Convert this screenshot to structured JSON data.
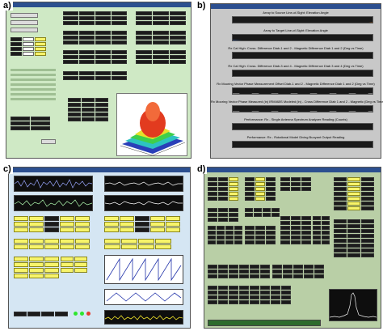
{
  "labels": {
    "a": "a)",
    "b": "b)",
    "c": "c)",
    "d": "d)"
  },
  "colors": {
    "panel_a_bg": "#cfe9c5",
    "panel_c_bg": "#d5e6f3",
    "panel_d_bg": "#b9cfa6",
    "panel_b_bg": "#c8c8c8",
    "titlebar": "#2c4f8f",
    "yellow": "#f7f46a",
    "dark": "#101010"
  },
  "panel_b": {
    "strips": [
      {
        "label": "Array to Source Line-of-Sight: Elevation Angle",
        "trace": "#ff8a1a"
      },
      {
        "label": "Array to Target Line-of-Sight: Elevation Angle",
        "trace": "#3b7bff"
      },
      {
        "label": "Rx Cal High: Cross. Difference Diab-1 and 2 - Magnetic Difference Diab 1 and 2 (Deg vs Time)",
        "trace": "#d8d8d8"
      },
      {
        "label": "Rx Cal High: Cross. Difference Diab-3 and 4 - Magnetic Difference Diab 3 and 4 (Deg vs Time)",
        "trace": "#d8d8d8"
      },
      {
        "label": "Rx Mooring Vector Phase Measurement Offset Diab-1 and 2 - Magnetic Difference Diab 1 and 2 (Deg vs Time)",
        "trace": "#ffffff"
      },
      {
        "label": "Rx Mooring Vector Phase Measured (in) IRM/ABS Modeled (in) - Cross Difference Diab 1 and 2 - Magnetic (Deg vs Time)",
        "trace": "#ffffff"
      },
      {
        "label": "Performance: Rx - Single Antenna Spectrum Analyzer Reading (Counts)",
        "trace": "#ffd21f"
      },
      {
        "label": "Performance: Rx - Rotational Model Diving Buoyant Output Reading",
        "trace": "#ffd21f"
      }
    ]
  }
}
